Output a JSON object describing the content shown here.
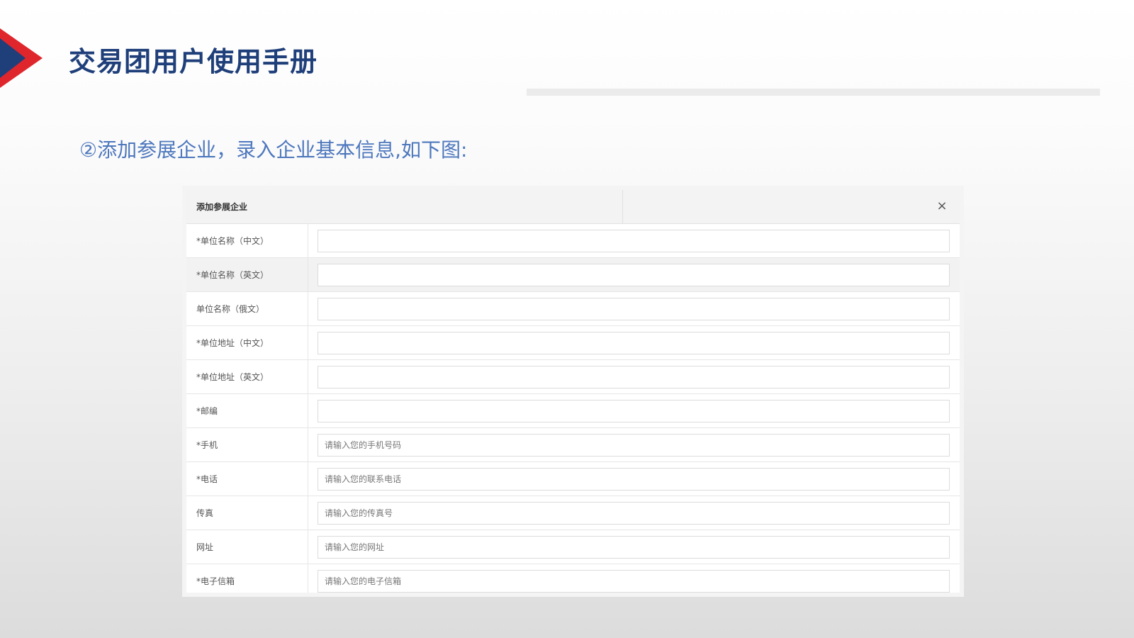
{
  "slide": {
    "title": "交易团用户使用手册",
    "subtitle": "②添加参展企业，录入企业基本信息,如下图:"
  },
  "colors": {
    "title": "#1f3f7a",
    "subtitle": "#4d77bd",
    "chevron_red": "#e0262d",
    "chevron_blue": "#1f3f7a"
  },
  "dialog": {
    "title": "添加参展企业",
    "close_icon": "close-icon",
    "close_glyph": "×",
    "rows": [
      {
        "label": "*单位名称（中文）",
        "placeholder": "",
        "value": ""
      },
      {
        "label": "*单位名称（英文）",
        "placeholder": "",
        "value": ""
      },
      {
        "label": "单位名称（俄文）",
        "placeholder": "",
        "value": ""
      },
      {
        "label": "*单位地址（中文）",
        "placeholder": "",
        "value": ""
      },
      {
        "label": "*单位地址（英文）",
        "placeholder": "",
        "value": ""
      },
      {
        "label": "*邮编",
        "placeholder": "",
        "value": ""
      },
      {
        "label": "*手机",
        "placeholder": "请输入您的手机号码",
        "value": ""
      },
      {
        "label": "*电话",
        "placeholder": "请输入您的联系电话",
        "value": ""
      },
      {
        "label": "传真",
        "placeholder": "请输入您的传真号",
        "value": ""
      },
      {
        "label": "网址",
        "placeholder": "请输入您的网址",
        "value": ""
      },
      {
        "label": "*电子信箱",
        "placeholder": "请输入您的电子信箱",
        "value": ""
      }
    ]
  }
}
